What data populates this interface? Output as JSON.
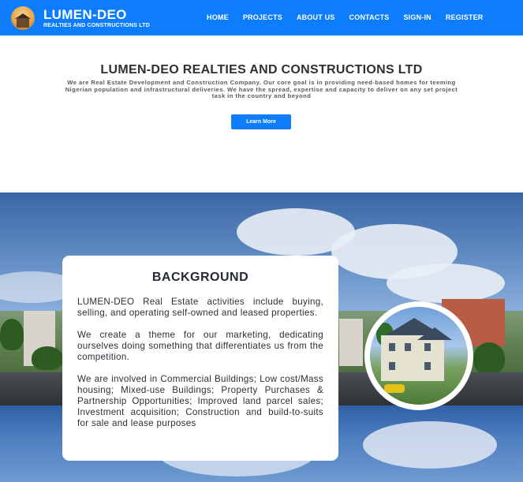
{
  "brand": {
    "title": "LUMEN-DEO",
    "subtitle": "REALTIES AND CONSTRUCTIONS LTD",
    "logo_icon": "building-logo-icon"
  },
  "nav": {
    "items": [
      {
        "label": "HOME"
      },
      {
        "label": "PROJECTS"
      },
      {
        "label": "ABOUT US"
      },
      {
        "label": "CONTACTS"
      },
      {
        "label": "SIGN-IN"
      },
      {
        "label": "REGISTER"
      }
    ]
  },
  "hero": {
    "title": "LUMEN-DEO REALTIES AND CONSTRUCTIONS LTD",
    "text": "We are Real Estate Development and Construction Company. Our core goal is in providing need-based homes for teeming Nigerian population and infrastructural deliveries. We have the spread, expertise and capacity to deliver on any set project task in the country and beyond",
    "button_label": "Learn More"
  },
  "background": {
    "title": "BACKGROUND",
    "paragraphs": [
      "LUMEN-DEO Real Estate activities include buying, selling, and operating self-owned and leased properties.",
      "We create a theme for our marketing, dedicating ourselves doing something that differentiates us from the competition.",
      "We are involved in Commercial Buildings; Low cost/Mass housing; Mixed-use Buildings; Property Purchases & Partnership Opportunities; Improved land parcel sales; Investment acquisition; Construction and build-to-suits for sale and lease purposes"
    ]
  },
  "colors": {
    "navbar": "#0d7dfb",
    "button": "#0d7dfb",
    "card": "#ffffff",
    "heading": "#2d2f33"
  }
}
